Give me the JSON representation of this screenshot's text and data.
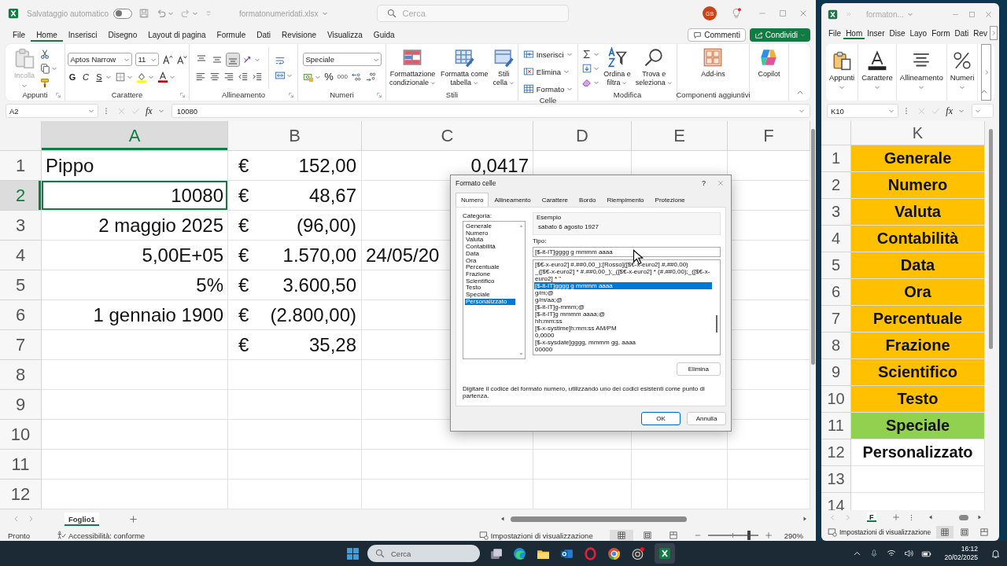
{
  "main_window": {
    "title_bar": {
      "autosave": {
        "label": "Salvataggio automatico",
        "on": false
      },
      "filename": "formatonumeridati.xlsx",
      "search_placeholder": "Cerca",
      "avatar": "GB"
    },
    "menu": {
      "tabs": [
        {
          "label": "File",
          "selected": false
        },
        {
          "label": "Home",
          "selected": true
        },
        {
          "label": "Inserisci",
          "selected": false
        },
        {
          "label": "Disegno",
          "selected": false
        },
        {
          "label": "Layout di pagina",
          "selected": false
        },
        {
          "label": "Formule",
          "selected": false
        },
        {
          "label": "Dati",
          "selected": false
        },
        {
          "label": "Revisione",
          "selected": false
        },
        {
          "label": "Visualizza",
          "selected": false
        },
        {
          "label": "Guida",
          "selected": false
        }
      ],
      "comments_button": "Commenti",
      "share_button": "Condividi"
    },
    "ribbon": {
      "clipboard": {
        "label": "Appunti",
        "paste": {
          "label": "Incolla",
          "disabled": true
        }
      },
      "font": {
        "label": "Carattere",
        "font_name": "Aptos Narrow",
        "font_size": "11",
        "bold": "G",
        "italic": "C",
        "underline": "S"
      },
      "alignment": {
        "label": "Allineamento",
        "vertical_align": [
          {
            "selected": false
          },
          {
            "selected": false
          },
          {
            "selected": true
          }
        ]
      },
      "number": {
        "label": "Numeri",
        "format": "Speciale",
        "percent": "%",
        "thousands": "000"
      },
      "styles": {
        "label": "Stili",
        "buttons": [
          "Formattazione\ncondizionale",
          "Formatta come\ntabella",
          "Stili\ncella"
        ]
      },
      "cells": {
        "label": "Celle",
        "buttons": [
          "Inserisci",
          "Elimina",
          "Formato"
        ]
      },
      "editing": {
        "label": "Modifica",
        "buttons": [
          "Ordina e\nfiltra",
          "Trova e\nseleziona"
        ]
      },
      "addins": {
        "label": "Componenti aggiuntivi",
        "button": "Add-ins"
      },
      "copilot": {
        "button": "Copilot"
      }
    },
    "formula_bar": {
      "name_box": "A2",
      "function_label": "fx",
      "formula": "10080"
    },
    "columns": [
      {
        "label": "A",
        "selected": true
      },
      {
        "label": "B",
        "selected": false
      },
      {
        "label": "C",
        "selected": false
      },
      {
        "label": "D",
        "selected": false
      },
      {
        "label": "E",
        "selected": false
      },
      {
        "label": "F",
        "selected": false
      }
    ],
    "rows": [
      {
        "number": "1",
        "selected": false,
        "a": {
          "text": "Pippo",
          "kind": "text",
          "selected": false
        },
        "b": {
          "symbol": "€",
          "amount": "152,00"
        },
        "c": {
          "text": "0,0417",
          "kind": "number"
        }
      },
      {
        "number": "2",
        "selected": true,
        "a": {
          "text": "10080",
          "kind": "number",
          "selected": true
        },
        "b": {
          "symbol": "€",
          "amount": "48,67"
        }
      },
      {
        "number": "3",
        "selected": false,
        "a": {
          "text": "2 maggio 2025",
          "kind": "number",
          "selected": false
        },
        "b": {
          "symbol": "€",
          "amount": "(96,00)"
        }
      },
      {
        "number": "4",
        "selected": false,
        "a": {
          "text": "5,00E+05",
          "kind": "number",
          "selected": false
        },
        "b": {
          "symbol": "€",
          "amount": "1.570,00"
        },
        "c": {
          "text": "24/05/20",
          "kind": "text"
        }
      },
      {
        "number": "5",
        "selected": false,
        "a": {
          "text": "5%",
          "kind": "number",
          "selected": false
        },
        "b": {
          "symbol": "€",
          "amount": "3.600,50"
        }
      },
      {
        "number": "6",
        "selected": false,
        "a": {
          "text": "1 gennaio 1900",
          "kind": "number",
          "selected": false
        },
        "b": {
          "symbol": "€",
          "amount": "(2.800,00)"
        }
      },
      {
        "number": "7",
        "selected": false,
        "b": {
          "symbol": "€",
          "amount": "35,28"
        }
      },
      {
        "number": "8",
        "selected": false
      },
      {
        "number": "9",
        "selected": false
      },
      {
        "number": "10",
        "selected": false
      },
      {
        "number": "11",
        "selected": false
      },
      {
        "number": "12",
        "selected": false
      }
    ],
    "sheet_tabs": [
      {
        "label": "Foglio1",
        "selected": true
      }
    ],
    "status_bar": {
      "status": "Pronto",
      "accessibility": "Accessibilità: conforme",
      "view_settings": "Impostazioni di visualizzazione",
      "views": [
        {
          "selected": true
        },
        {
          "selected": false
        },
        {
          "selected": false
        }
      ],
      "zoom": {
        "level": 0.81,
        "reading": "290%"
      }
    }
  },
  "dialog": {
    "title": "Formato celle",
    "help": "?",
    "tabs": [
      {
        "label": "Numero",
        "selected": true
      },
      {
        "label": "Allineamento",
        "selected": false
      },
      {
        "label": "Carattere",
        "selected": false
      },
      {
        "label": "Bordo",
        "selected": false
      },
      {
        "label": "Riempimento",
        "selected": false
      },
      {
        "label": "Protezione",
        "selected": false
      }
    ],
    "category_label": "Categoria:",
    "categories": [
      {
        "label": "Generale",
        "selected": false
      },
      {
        "label": "Numero",
        "selected": false
      },
      {
        "label": "Valuta",
        "selected": false
      },
      {
        "label": "Contabilità",
        "selected": false
      },
      {
        "label": "Data",
        "selected": false
      },
      {
        "label": "Ora",
        "selected": false
      },
      {
        "label": "Percentuale",
        "selected": false
      },
      {
        "label": "Frazione",
        "selected": false
      },
      {
        "label": "Scientifico",
        "selected": false
      },
      {
        "label": "Testo",
        "selected": false
      },
      {
        "label": "Speciale",
        "selected": false
      },
      {
        "label": "Personalizzato",
        "selected": true
      }
    ],
    "sample_label": "Esempio",
    "sample": "sabato 6 agosto 1927",
    "type_label": "Tipo:",
    "type_value": "[$-it-IT]gggg g mmmm aaaa",
    "formats": [
      {
        "text": "[$€-x-euro2] #.##0,00_);[Rosso]([$€-x-euro2] #.##0,00)",
        "selected": false
      },
      {
        "text": "_([$€-x-euro2] * #.##0,00_);_([$€-x-euro2] * (#.##0,00);_([$€-x-euro2] * \"",
        "selected": false
      },
      {
        "text": "[$-it-IT]gggg g mmmm aaaa",
        "selected": true
      },
      {
        "text": "g/m;@",
        "selected": false
      },
      {
        "text": "g/m/aa;@",
        "selected": false
      },
      {
        "text": "[$-it-IT]g-mmm;@",
        "selected": false
      },
      {
        "text": "[$-it-IT]g mmmm aaaa;@",
        "selected": false
      },
      {
        "text": "hh:mm:ss",
        "selected": false
      },
      {
        "text": "[$-x-systime]h:mm:ss AM/PM",
        "selected": false
      },
      {
        "text": "0,0000",
        "selected": false
      },
      {
        "text": "[$-x-sysdate]gggg, mmmm gg, aaaa",
        "selected": false
      },
      {
        "text": "00000",
        "selected": false
      }
    ],
    "delete_button": "Elimina",
    "hint": "Digitare il codice del formato numero, utilizzando uno dei codici esistenti come punto di partenza.",
    "ok_button": "OK",
    "cancel_button": "Annulla"
  },
  "side_window": {
    "filename": "formaton...",
    "menu_tabs": [
      {
        "label": "File",
        "selected": false
      },
      {
        "label": "Hom",
        "selected": true
      },
      {
        "label": "Inser",
        "selected": false
      },
      {
        "label": "Dise",
        "selected": false
      },
      {
        "label": "Layo",
        "selected": false
      },
      {
        "label": "Form",
        "selected": false
      },
      {
        "label": "Dati",
        "selected": false
      },
      {
        "label": "Rev",
        "selected": false
      }
    ],
    "ribbon_buttons": [
      "Appunti",
      "Carattere",
      "Allineamento",
      "Numeri"
    ],
    "formula_bar": {
      "name_box": "K10",
      "function_label": "fx"
    },
    "column": "K",
    "rows": [
      {
        "number": "1",
        "text": "Generale",
        "color": "#ffc000"
      },
      {
        "number": "2",
        "text": "Numero",
        "color": "#ffc000"
      },
      {
        "number": "3",
        "text": "Valuta",
        "color": "#ffc000"
      },
      {
        "number": "4",
        "text": "Contabilità",
        "color": "#ffc000"
      },
      {
        "number": "5",
        "text": "Data",
        "color": "#ffc000"
      },
      {
        "number": "6",
        "text": "Ora",
        "color": "#ffc000"
      },
      {
        "number": "7",
        "text": "Percentuale",
        "color": "#ffc000"
      },
      {
        "number": "8",
        "text": "Frazione",
        "color": "#ffc000"
      },
      {
        "number": "9",
        "text": "Scientifico",
        "color": "#ffc000"
      },
      {
        "number": "10",
        "text": "Testo",
        "color": "#ffc000"
      },
      {
        "number": "11",
        "text": "Speciale",
        "color": "#92d050"
      },
      {
        "number": "12",
        "text": "Personalizzato"
      },
      {
        "number": "13"
      },
      {
        "number": "14"
      }
    ],
    "sheet_tabs": [
      {
        "label": "F",
        "selected": true
      }
    ],
    "status_bar": {
      "view_settings": "Impostazioni di visualizzazione",
      "views": [
        {
          "selected": true
        },
        {
          "selected": false
        },
        {
          "selected": false
        }
      ]
    }
  },
  "taskbar": {
    "search_placeholder": "Cerca",
    "time": "16:12",
    "date": "20/02/2025"
  }
}
